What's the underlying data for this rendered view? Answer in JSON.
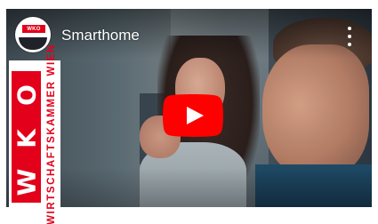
{
  "video": {
    "title": "Smarthome",
    "play_button_label": "Play",
    "more_options_label": "More options"
  },
  "channel": {
    "avatar_badge": "WKO",
    "avatar_caption": "WIEN"
  },
  "logo": {
    "letters": [
      "W",
      "K",
      "O"
    ],
    "vertical_text": "WIRTSCHAFTSKAMMER WIEN"
  },
  "colors": {
    "brand_red": "#e2001a",
    "play_red": "#ff0000",
    "title_text": "#ffffff"
  },
  "icons": {
    "play": "play-triangle-icon",
    "more": "vertical-dots-icon"
  }
}
